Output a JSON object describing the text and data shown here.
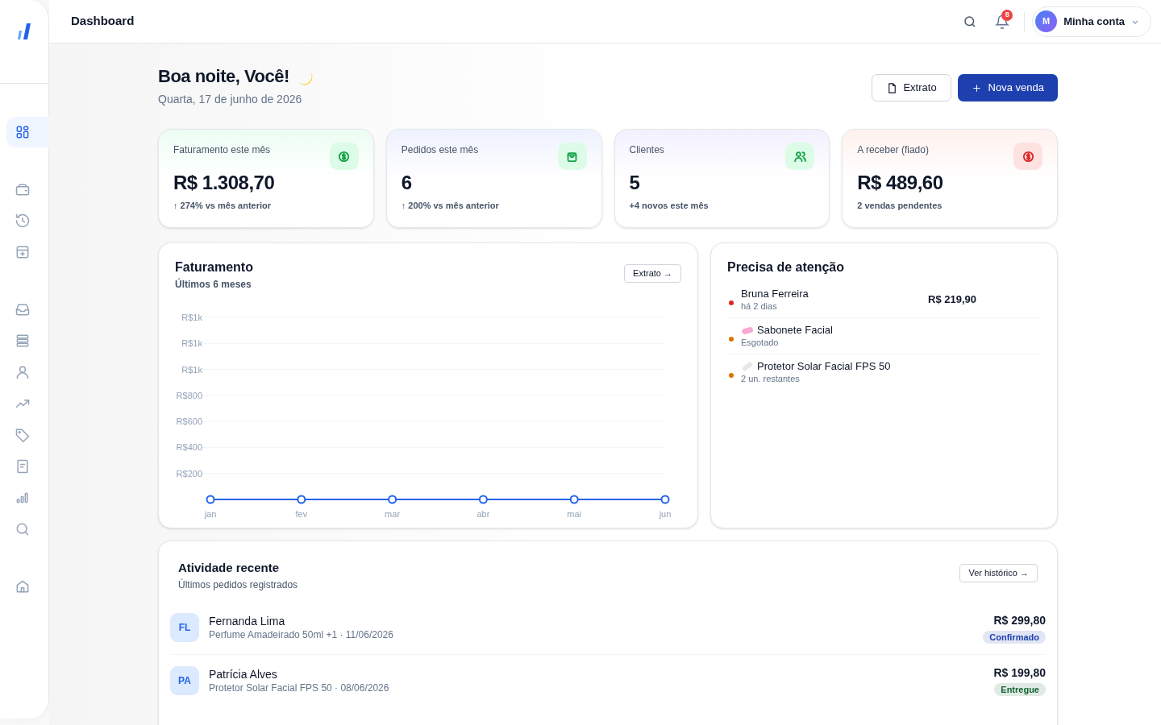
{
  "header": {
    "title": "Dashboard",
    "notifications": "8",
    "account": {
      "initial": "M",
      "label": "Minha conta"
    }
  },
  "sidebar": {
    "items": [
      {
        "selected": true
      },
      {
        "selected": false
      },
      {
        "selected": false
      },
      {
        "selected": false
      },
      {
        "selected": false
      },
      {
        "selected": false
      },
      {
        "selected": false
      },
      {
        "selected": false
      },
      {
        "selected": false
      },
      {
        "selected": false
      },
      {
        "selected": false
      },
      {
        "selected": false
      },
      {
        "selected": false
      }
    ]
  },
  "greeting": {
    "title": "Boa noite, Você!",
    "date": "Quarta, 17 de junho de 2026"
  },
  "actions": [
    {
      "kind": "secondary",
      "label": "Extrato"
    },
    {
      "kind": "primary",
      "label": "Nova venda"
    }
  ],
  "stats": [
    {
      "label": "Faturamento este mês",
      "value": "R$ 1.308,70",
      "note": "↑ 274% vs mês anterior",
      "color": "#16a34a"
    },
    {
      "label": "Pedidos este mês",
      "value": "6",
      "note": "↑ 200% vs mês anterior",
      "color": "#16a34a"
    },
    {
      "label": "Clientes",
      "value": "5",
      "note": "+4 novos este mês",
      "color": "#16a34a"
    },
    {
      "label": "A receber (fiado)",
      "value": "R$ 489,60",
      "note": "2 vendas pendentes",
      "color": "#dc2626"
    }
  ],
  "revenue": {
    "title": "Faturamento",
    "subtitle": "Últimos 6 meses",
    "button": "Extrato →",
    "y_labels": [
      "R$1k",
      "R$1k",
      "R$1k",
      "R$800",
      "R$600",
      "R$400",
      "R$200"
    ],
    "x_labels": [
      "jan",
      "fev",
      "mar",
      "abr",
      "mai",
      "jun"
    ]
  },
  "attention": {
    "title": "Precisa de atenção",
    "items": [
      {
        "kind": "debt",
        "name": "Bruna Ferreira",
        "detail": "há 2 dias",
        "amount": "R$ 219,90",
        "color": "#dc2626"
      },
      {
        "kind": "stock",
        "name": "Sabonete Facial",
        "detail": "Esgotado",
        "color": "#d97706"
      },
      {
        "kind": "stock",
        "name": "Protetor Solar Facial FPS 50",
        "detail": "2 un. restantes",
        "color": "#d97706"
      }
    ]
  },
  "activity": {
    "title": "Atividade recente",
    "subtitle": "Últimos pedidos registrados",
    "button": "Ver histórico →",
    "rows": [
      {
        "initials": "FL",
        "name": "Fernanda Lima",
        "detail": "Perfume Amadeirado 50ml +1 · 11/06/2026",
        "amount": "R$ 299,80",
        "status": "Confirmado",
        "color": "#1e40af"
      },
      {
        "initials": "PA",
        "name": "Patrícia Alves",
        "detail": "Protetor Solar Facial FPS 50 · 08/06/2026",
        "amount": "R$ 199,80",
        "status": "Entregue",
        "color": "#166534"
      }
    ]
  }
}
